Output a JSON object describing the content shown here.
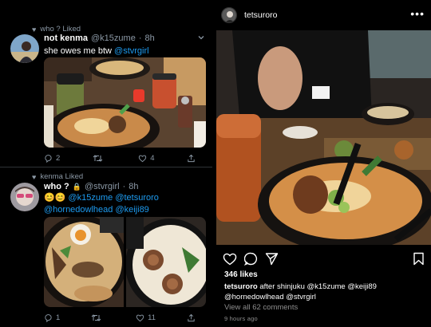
{
  "tweets": [
    {
      "context": "who ? Liked",
      "name": "not kenma",
      "handle": "@k15zume",
      "dot": "·",
      "time": "8h",
      "text_plain": "she owes me btw ",
      "text_mention": "@stvrgirl",
      "stats": {
        "replies": "2",
        "retweets": "",
        "likes": "4"
      }
    },
    {
      "context": "kenma Liked",
      "name": "who ?",
      "lock": "🔒",
      "handle": "@stvrgirl",
      "dot": "·",
      "time": "8h",
      "emoji": "😊😊",
      "mentions_line1": "@k15zume @tetsuroro",
      "mentions_line2": "@hornedowlhead @keiji89",
      "stats": {
        "replies": "1",
        "retweets": "",
        "likes": "11"
      }
    }
  ],
  "instagram": {
    "username": "tetsuroro",
    "more": "•••",
    "likes": "346 likes",
    "caption_user": "tetsuroro",
    "caption_text": "after shinjuku @k15zume @keiji89 @hornedowlhead @stvrgirl",
    "view_all": "View all 62 comments",
    "time_ago": "9 hours ago"
  },
  "colors": {
    "background": "#000000",
    "link": "#1d9bf0",
    "muted": "#8b98a5",
    "divider": "#2f3336"
  },
  "icons": [
    "heart-icon",
    "chevron-down-icon",
    "reply-icon",
    "retweet-icon",
    "like-icon",
    "share-icon",
    "lock-icon",
    "comment-icon",
    "send-icon",
    "bookmark-icon",
    "more-icon"
  ]
}
